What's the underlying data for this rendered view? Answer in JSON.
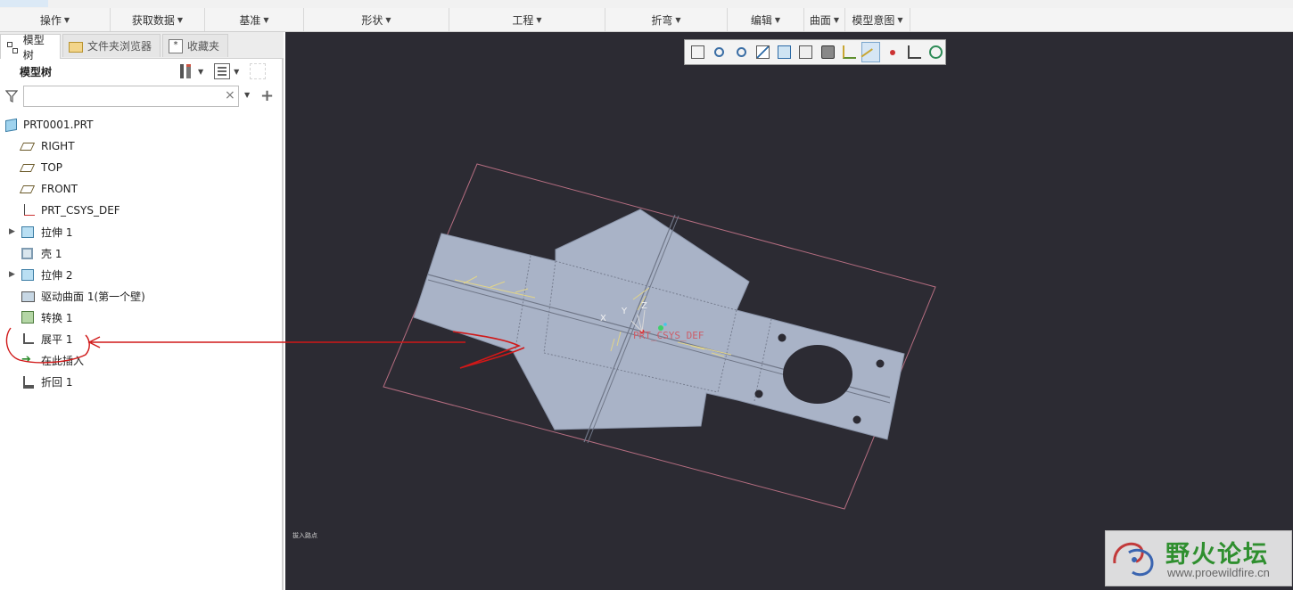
{
  "ribbon": {
    "groups": [
      {
        "label": "操作",
        "width": 124
      },
      {
        "label": "获取数据",
        "width": 106
      },
      {
        "label": "基准",
        "width": 111
      },
      {
        "label": "形状",
        "width": 163
      },
      {
        "label": "工程",
        "width": 175
      },
      {
        "label": "折弯",
        "width": 137
      },
      {
        "label": "编辑",
        "width": 86
      },
      {
        "label": "曲面",
        "width": 46
      },
      {
        "label": "模型意图",
        "width": 73
      }
    ]
  },
  "left_panel": {
    "tabs": [
      {
        "label": "模型树",
        "icon": "model-tree-icon",
        "active": true
      },
      {
        "label": "文件夹浏览器",
        "icon": "folder-icon",
        "active": false
      },
      {
        "label": "收藏夹",
        "icon": "favorites-icon",
        "active": false
      }
    ],
    "tree_title": "模型树",
    "search": {
      "value": "",
      "placeholder": ""
    },
    "tree_items": [
      {
        "label": "PRT0001.PRT",
        "icon": "part-icon",
        "indent": 0,
        "expandable": false
      },
      {
        "label": "RIGHT",
        "icon": "datum-plane-icon",
        "indent": 1,
        "expandable": false
      },
      {
        "label": "TOP",
        "icon": "datum-plane-icon",
        "indent": 1,
        "expandable": false
      },
      {
        "label": "FRONT",
        "icon": "datum-plane-icon",
        "indent": 1,
        "expandable": false
      },
      {
        "label": "PRT_CSYS_DEF",
        "icon": "csys-icon",
        "indent": 1,
        "expandable": false
      },
      {
        "label": "拉伸 1",
        "icon": "extrude-icon",
        "indent": 1,
        "expandable": true
      },
      {
        "label": "壳 1",
        "icon": "shell-icon",
        "indent": 1,
        "expandable": false
      },
      {
        "label": "拉伸 2",
        "icon": "extrude-icon",
        "indent": 1,
        "expandable": true
      },
      {
        "label": "驱动曲面 1(第一个壁)",
        "icon": "driving-surface-icon",
        "indent": 1,
        "expandable": false
      },
      {
        "label": "转换 1",
        "icon": "conversion-icon",
        "indent": 1,
        "expandable": false
      },
      {
        "label": "展平 1",
        "icon": "unbend-icon",
        "indent": 1,
        "expandable": false
      },
      {
        "label": "在此插入",
        "icon": "insert-here-icon",
        "indent": 1,
        "expandable": false
      },
      {
        "label": "折回 1",
        "icon": "bend-back-icon",
        "indent": 1,
        "expandable": false
      }
    ]
  },
  "viewport": {
    "background": "#2c2b33",
    "toolbar_buttons": [
      {
        "name": "zoom-fit-icon"
      },
      {
        "name": "zoom-in-icon"
      },
      {
        "name": "zoom-out-icon"
      },
      {
        "name": "refit-icon"
      },
      {
        "name": "named-view-icon"
      },
      {
        "name": "saved-orientation-icon"
      },
      {
        "name": "display-style-icon"
      },
      {
        "name": "datum-display-icon"
      },
      {
        "name": "axis-display-icon",
        "active": true
      },
      {
        "name": "point-display-icon"
      },
      {
        "name": "csys-display-icon"
      },
      {
        "name": "spin-center-icon"
      }
    ],
    "labels": {
      "csys": "PRT_CSYS_DEF",
      "x": "X",
      "y": "Y",
      "z": "Z"
    },
    "status_text": "拔入路点"
  },
  "watermark": {
    "title": "野火论坛",
    "url": "www.proewildfire.cn"
  },
  "colors": {
    "accent": "#3b6ea5",
    "annotation": "#d01818",
    "sheet": "#a9b3c7"
  }
}
